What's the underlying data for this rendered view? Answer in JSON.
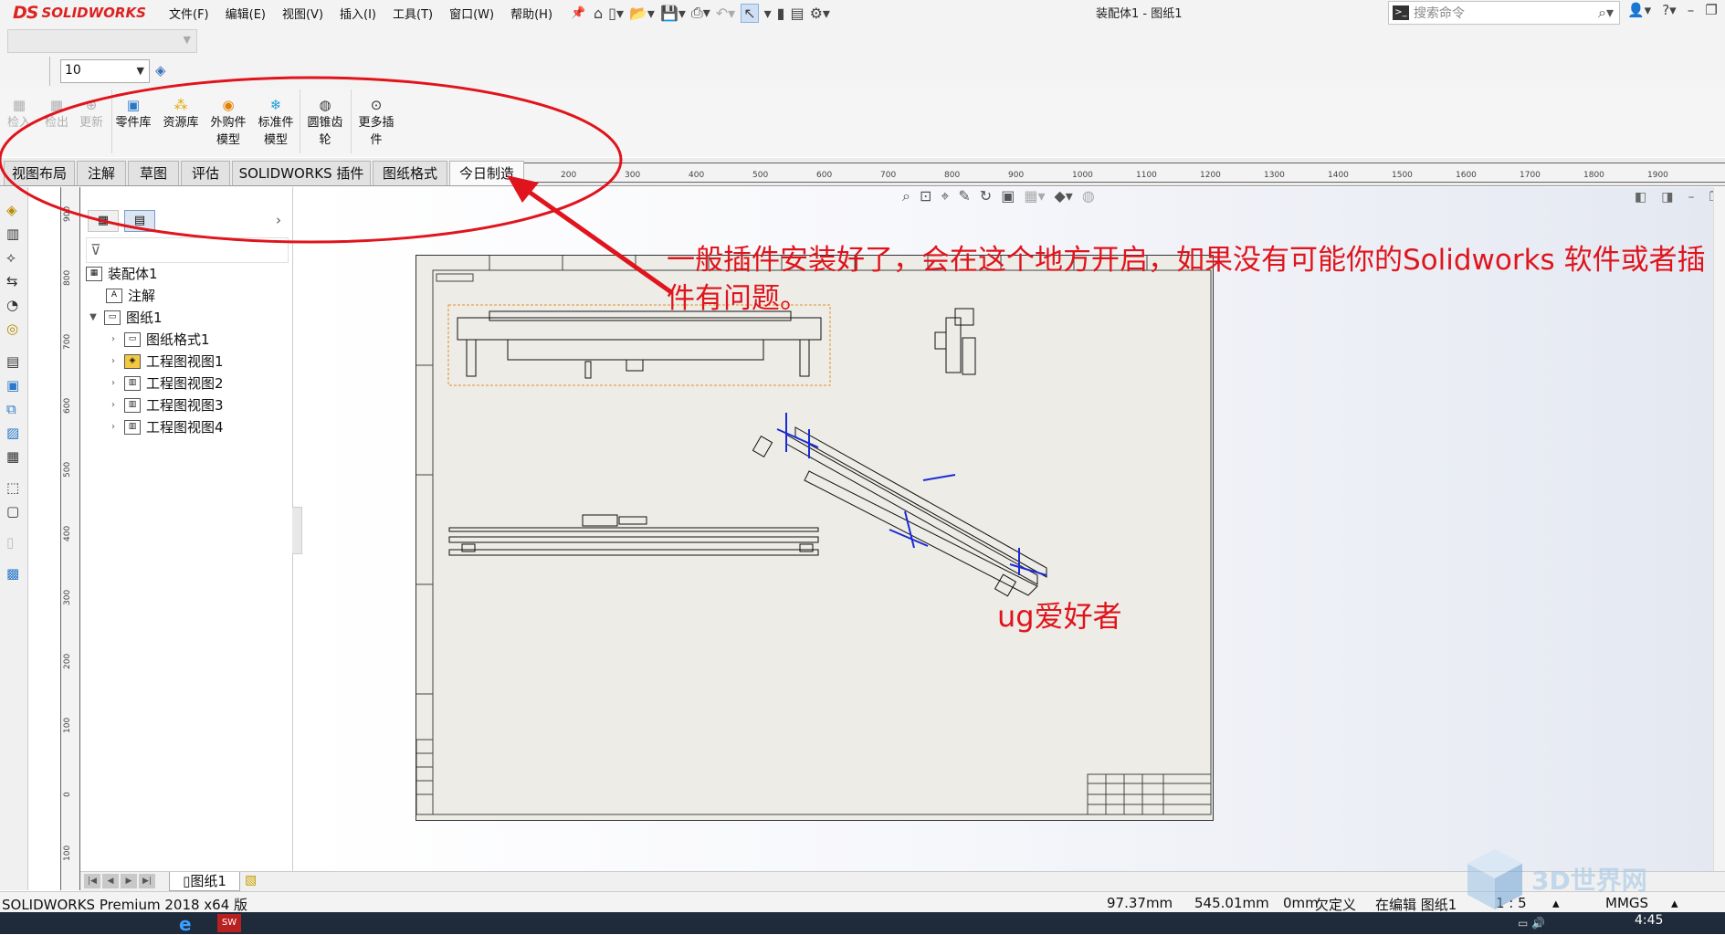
{
  "titlebar": {
    "brand": "SOLIDWORKS",
    "brand_prefix": "DS",
    "menu": [
      "文件(F)",
      "编辑(E)",
      "视图(V)",
      "插入(I)",
      "工具(T)",
      "窗口(W)",
      "帮助(H)"
    ],
    "doc_title": "装配体1 - 图纸1",
    "search_placeholder": "搜索命令"
  },
  "format": {
    "font_size_value": "10"
  },
  "ribbon": {
    "disabled_buttons": [
      "检入",
      "检出",
      "更新"
    ],
    "buttons": [
      {
        "line1": "零件库",
        "line2": "",
        "icon": "parts-library-icon"
      },
      {
        "line1": "资源库",
        "line2": "",
        "icon": "resource-library-icon"
      },
      {
        "line1": "外购件",
        "line2": "模型",
        "icon": "purchased-part-icon"
      },
      {
        "line1": "标准件",
        "line2": "模型",
        "icon": "standard-part-icon"
      },
      {
        "line1": "圆锥齿",
        "line2": "轮",
        "icon": "bevel-gear-icon"
      },
      {
        "line1": "更多插",
        "line2": "件",
        "icon": "more-plugins-icon"
      }
    ],
    "check_in_partial": "检入"
  },
  "tabs": [
    "视图布局",
    "注解",
    "草图",
    "评估",
    "SOLIDWORKS 插件",
    "图纸格式",
    "今日制造"
  ],
  "active_tab": "今日制造",
  "ruler": {
    "h_ticks": [
      "200",
      "300",
      "400",
      "500",
      "600",
      "700",
      "800",
      "900",
      "1000",
      "1100",
      "1200",
      "1300",
      "1400",
      "1500",
      "1600",
      "1700",
      "1800",
      "1900"
    ],
    "v_ticks": [
      "900",
      "800",
      "700",
      "600",
      "500",
      "400",
      "300",
      "200",
      "100",
      "0",
      "100"
    ]
  },
  "tree": {
    "root": "装配体1",
    "annotation": "注解",
    "sheet": "图纸1",
    "children": [
      "图纸格式1",
      "工程图视图1",
      "工程图视图2",
      "工程图视图3",
      "工程图视图4"
    ]
  },
  "annotations": {
    "main": "一般插件安装好了，会在这个地方开启，如果没有可能你的Solidworks 软件或者插件有问题。",
    "overlay": "ug爱好者"
  },
  "sheet_tab": "图纸1",
  "status": {
    "product": "SOLIDWORKS Premium 2018 x64 版",
    "x": "97.37mm",
    "y": "545.01mm",
    "z": "0mm",
    "state": "欠定义",
    "editing": "在编辑 图纸1",
    "scale": "1 : 5",
    "units": "MMGS"
  },
  "taskbar": {
    "clock": "4:45"
  },
  "watermark": "3D世界网",
  "colors": {
    "annotation_red": "#e0141c",
    "sheet_bg": "#edece6",
    "brand_red": "#d22222"
  }
}
